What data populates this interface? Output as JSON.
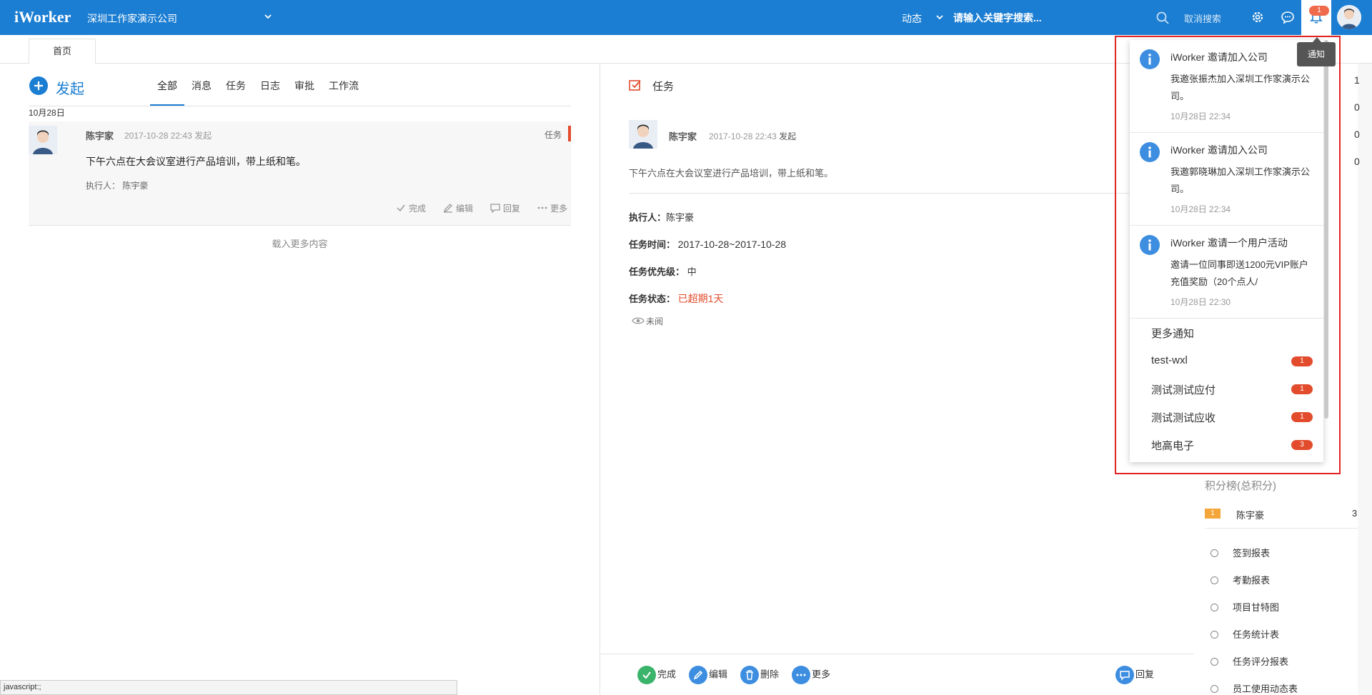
{
  "header": {
    "logo": "iWorker",
    "company": "深圳工作家演示公司",
    "dynamic_label": "动态",
    "search_placeholder": "请输入关键字搜索...",
    "cancel_search": "取消搜索",
    "notification_count": "1",
    "brand_color": "#1b7ed2"
  },
  "tabs": {
    "home": "首页"
  },
  "feed": {
    "compose_label": "发起",
    "filters": [
      "全部",
      "消息",
      "任务",
      "日志",
      "审批",
      "工作流"
    ],
    "active_filter": "全部",
    "date_label": "10月28日",
    "item": {
      "name": "陈宇家",
      "time": "2017-10-28 22:43 发起",
      "type": "任务",
      "content": "下午六点在大会议室进行产品培训，带上纸和笔。",
      "assignee": "执行人： 陈宇豪",
      "actions": [
        "完成",
        "编辑",
        "回复",
        "更多"
      ]
    },
    "load_more": "载入更多内容"
  },
  "detail": {
    "title": "任务",
    "name": "陈宇家",
    "time": "2017-10-28 22:43",
    "initiated": "发起",
    "content": "下午六点在大会议室进行产品培训，带上纸和笔。",
    "assignee_label": "执行人：",
    "assignee_value": "陈宇豪",
    "time_label": "任务时间：",
    "time_value": "2017-10-28~2017-10-28",
    "priority_label": "任务优先级：",
    "priority_value": "中",
    "status_label": "任务状态：",
    "status_value": "已超期1天",
    "unread": "未阅",
    "actions": {
      "complete": "完成",
      "edit": "编辑",
      "delete": "删除",
      "more": "更多",
      "reply": "回复"
    }
  },
  "right_panel": {
    "counts": [
      "1",
      "0",
      "0",
      "0"
    ],
    "rank_title": "积分榜(总积分)",
    "rank": {
      "position": "1",
      "name": "陈宇豪",
      "score": "3"
    },
    "reports": [
      "签到报表",
      "考勤报表",
      "项目甘特图",
      "任务统计表",
      "任务评分报表",
      "员工使用动态表"
    ]
  },
  "notifications": {
    "tooltip": "通知",
    "items": [
      {
        "title": "iWorker 邀请加入公司",
        "body": "我邀张振杰加入深圳工作家演示公司。",
        "time": "10月28日 22:34"
      },
      {
        "title": "iWorker 邀请加入公司",
        "body": "我邀郭晓琳加入深圳工作家演示公司。",
        "time": "10月28日 22:34"
      },
      {
        "title": "iWorker 邀请一个用户活动",
        "body": "邀请一位同事即送1200元VIP账户充值奖励（20个点人/",
        "time": "10月28日 22:30"
      }
    ],
    "more": "更多通知",
    "groups": [
      {
        "name": "test-wxl",
        "count": "1"
      },
      {
        "name": "测试测试应付",
        "count": "1"
      },
      {
        "name": "测试测试应收",
        "count": "1"
      },
      {
        "name": "地高电子",
        "count": "3"
      }
    ]
  },
  "status_bar": "javascript:;"
}
